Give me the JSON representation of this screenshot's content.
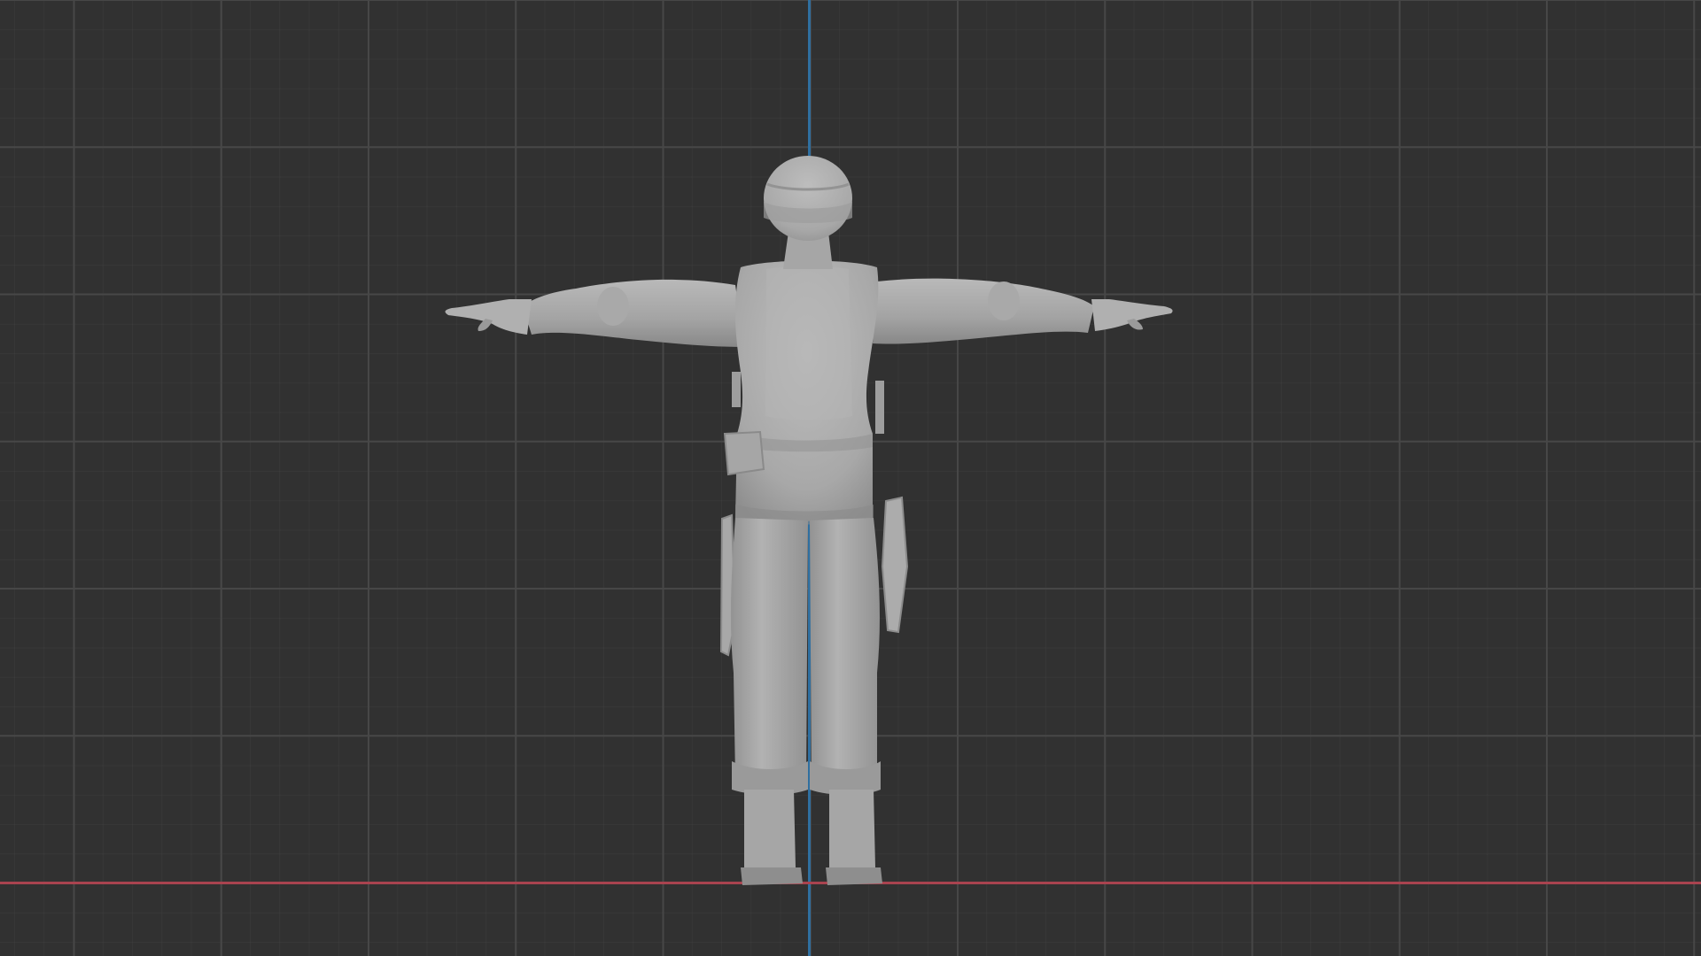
{
  "viewport": {
    "view": "front-orthographic",
    "background_color": "#313131",
    "grid_color": "#474747",
    "x_axis_color": "#a9434f",
    "z_axis_color": "#2f6fa0",
    "object": {
      "type": "mesh",
      "subject": "soldier-character",
      "pose": "t-pose",
      "shading": "solid",
      "material_color": "#a9a9a9"
    }
  }
}
